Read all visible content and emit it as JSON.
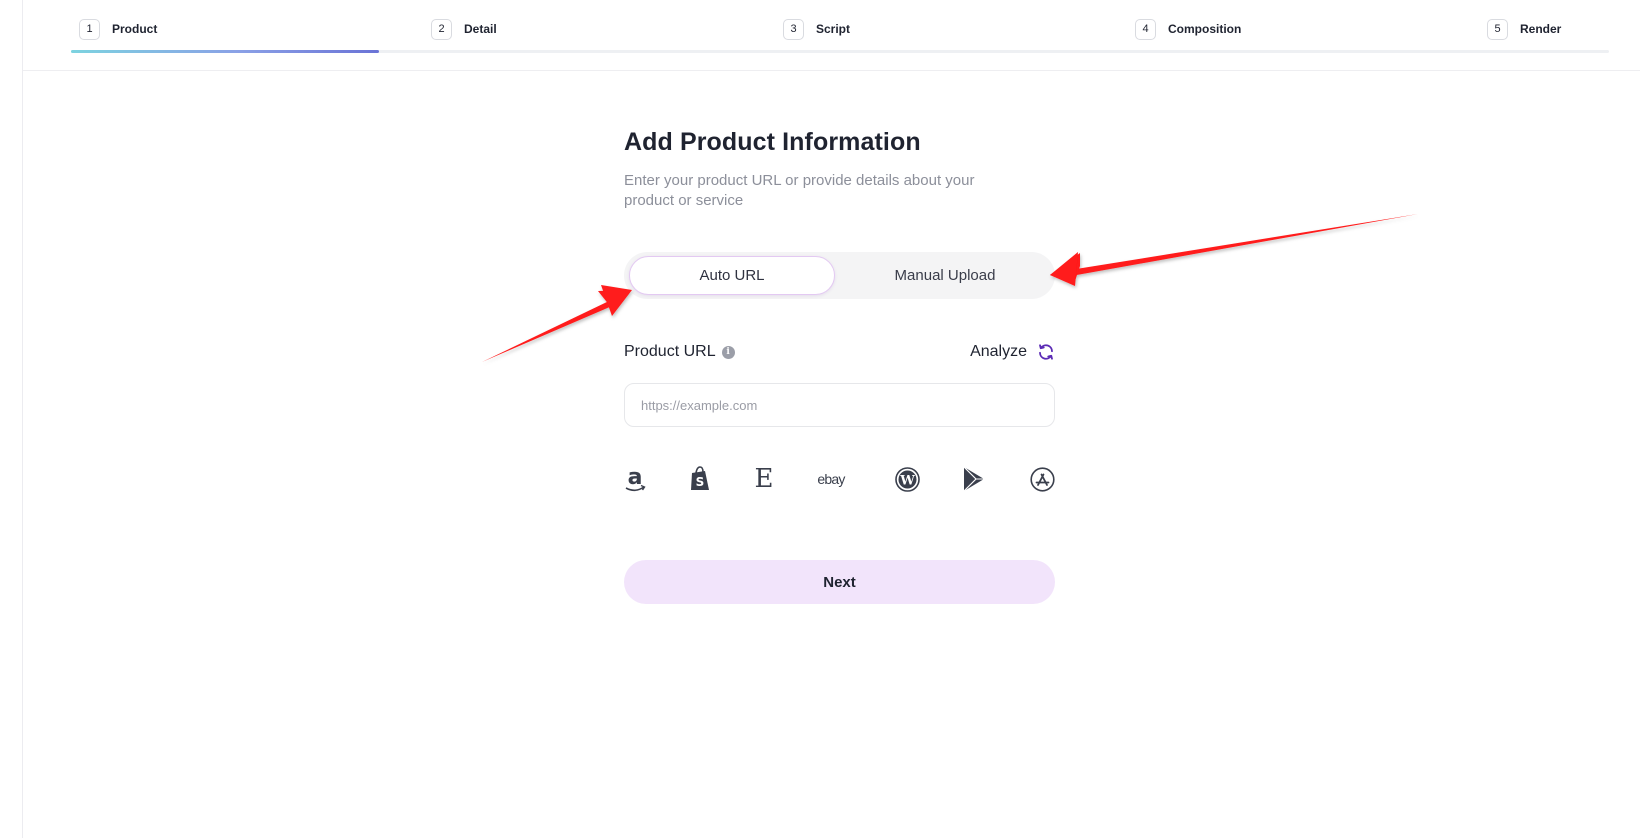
{
  "stepper": {
    "steps": [
      {
        "num": "1",
        "label": "Product"
      },
      {
        "num": "2",
        "label": "Detail"
      },
      {
        "num": "3",
        "label": "Script"
      },
      {
        "num": "4",
        "label": "Composition"
      },
      {
        "num": "5",
        "label": "Render"
      }
    ],
    "progress_fraction": 0.2,
    "progress_colors": [
      "#7dd3e0",
      "#6a73d6"
    ]
  },
  "form": {
    "title": "Add Product Information",
    "subtitle": "Enter your product URL or provide details about your product or service",
    "toggle": {
      "options": [
        "Auto URL",
        "Manual Upload"
      ],
      "selected": "Auto URL"
    },
    "url_label": "Product URL",
    "analyze_label": "Analyze",
    "url_input": {
      "value": "",
      "placeholder": "https://example.com"
    },
    "platforms": [
      "amazon-icon",
      "shopify-icon",
      "etsy-icon",
      "ebay-icon",
      "wordpress-icon",
      "google-play-icon",
      "app-store-icon"
    ],
    "ebay_text": "ebay",
    "etsy_text": "E",
    "next_label": "Next"
  },
  "colors": {
    "accent_purple": "#5b2bb5",
    "next_bg": "#f2e4fb",
    "annotation_red": "#ff0000"
  }
}
